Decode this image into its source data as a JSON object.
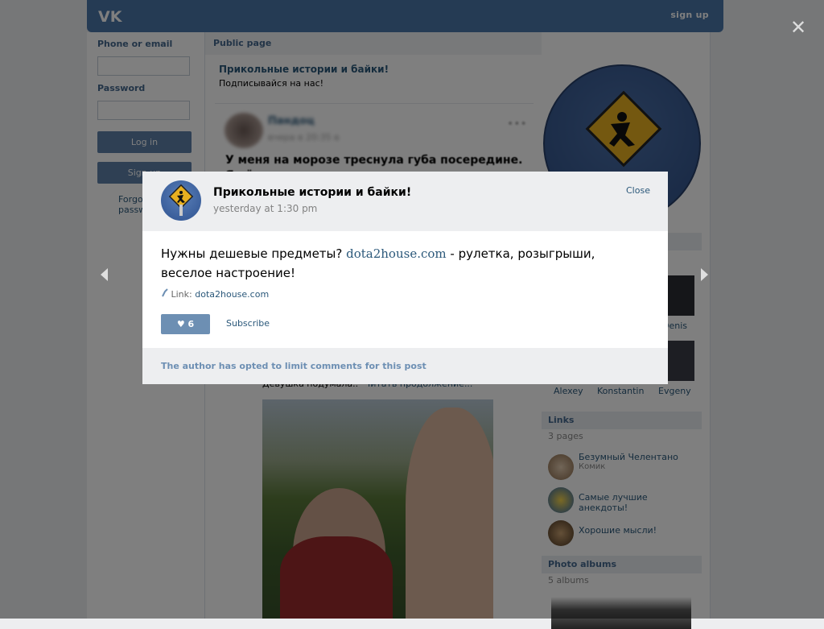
{
  "topbar": {
    "signup_label": "sign up"
  },
  "login": {
    "phone_label": "Phone or email",
    "password_label": "Password",
    "login_button": "Log in",
    "signup_button": "Sign up",
    "forgot_line1": "Forgot",
    "forgot_line2": "password?"
  },
  "center": {
    "section_title": "Public page",
    "page_name": "Прикольные истории и байки!",
    "page_status": "Подписывайся на нас!",
    "post_author": "Пандоц",
    "post_date": "вчера в 20:35 в",
    "post_text": "У меня на морозе треснула губа посередине. Я её",
    "photo_caption": "Девушка подумала..",
    "read_more": "Читать продолжение..."
  },
  "right": {
    "members": [
      {
        "name": "Denis"
      },
      {
        "name": "Alexey"
      },
      {
        "name": "Konstantin"
      },
      {
        "name": "Evgeny"
      }
    ],
    "links": {
      "title": "Links",
      "count": "3 pages",
      "items": [
        {
          "title": "Безумный Челентано",
          "subtitle": "Комик"
        },
        {
          "title": "Самые лучшие анекдоты!",
          "subtitle": ""
        },
        {
          "title": "Хорошие мысли!",
          "subtitle": ""
        }
      ]
    },
    "albums": {
      "title": "Photo albums",
      "count": "5 albums"
    }
  },
  "modal": {
    "title": "Прикольные истории и байки!",
    "date": "yesterday at 1:30 pm",
    "close_label": "Close",
    "text_before": "Нужны дешевые предметы?",
    "text_link": "dota2house.com",
    "text_after": "- рулетка, розыгрыши, веселое настроение!",
    "link_label": "Link:",
    "link_url": "dota2house.com",
    "like_count": "6",
    "subscribe_label": "Subscribe",
    "comments_notice": "The author has opted to limit comments for this post"
  },
  "colors": {
    "brand": "#4a76a8",
    "link": "#2b587a",
    "button": "#5e81a8",
    "like_button": "#6d8fb3"
  },
  "icons": [
    "vk-logo",
    "close-x-icon",
    "arrow-left-icon",
    "arrow-right-icon",
    "heart-icon",
    "link-icon",
    "road-sign-icon"
  ]
}
